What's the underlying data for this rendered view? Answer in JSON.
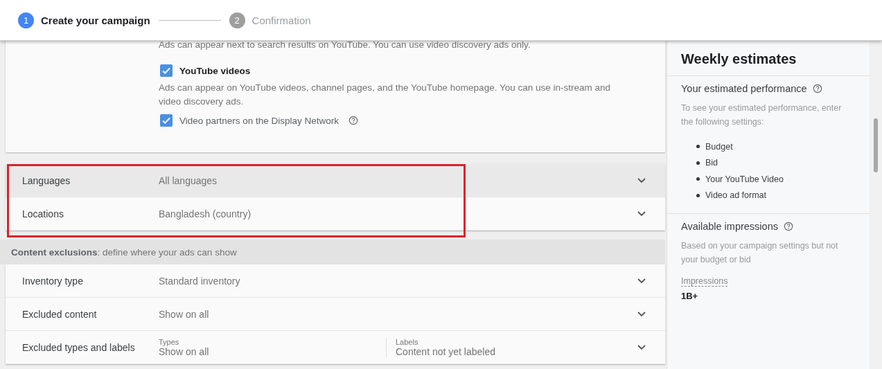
{
  "stepper": [
    {
      "number": "1",
      "label": "Create your campaign",
      "selected": true
    },
    {
      "number": "2",
      "label": "Confirmation",
      "selected": false
    }
  ],
  "networks": {
    "cut_text": "Ads can appear next to search results on YouTube. You can use video discovery ads only.",
    "options": [
      {
        "label": "YouTube videos",
        "checked": true,
        "bold": true,
        "description": "Ads can appear on YouTube videos, channel pages, and the YouTube homepage. You can use in-stream and video discovery ads.",
        "help": false
      },
      {
        "label": "Video partners on the Display Network",
        "checked": true,
        "bold": false,
        "help": true
      }
    ]
  },
  "targeting_rows": [
    {
      "label": "Languages",
      "value": "All languages",
      "highlighted": true
    },
    {
      "label": "Locations",
      "value": "Bangladesh (country)",
      "highlighted": false
    }
  ],
  "content_exclusions": {
    "title": "Content exclusions",
    "subtitle": ": define where your ads can show",
    "rows": [
      {
        "kind": "single",
        "label": "Inventory type",
        "value": "Standard inventory"
      },
      {
        "kind": "single",
        "label": "Excluded content",
        "value": "Show on all"
      },
      {
        "kind": "split",
        "label": "Excluded types and labels",
        "fields": [
          {
            "caption": "Types",
            "value": "Show on all"
          },
          {
            "caption": "Labels",
            "value": "Content not yet labeled"
          }
        ]
      }
    ]
  },
  "estimates": {
    "title": "Weekly estimates",
    "performance": {
      "heading": "Your estimated performance",
      "note": "To see your estimated performance, enter the following settings:",
      "items": [
        "Budget",
        "Bid",
        "Your YouTube Video",
        "Video ad format"
      ]
    },
    "impressions": {
      "heading": "Available impressions",
      "note": "Based on your campaign settings but not your budget or bid",
      "metric_label": "Impressions",
      "metric_value": "1B+"
    }
  }
}
